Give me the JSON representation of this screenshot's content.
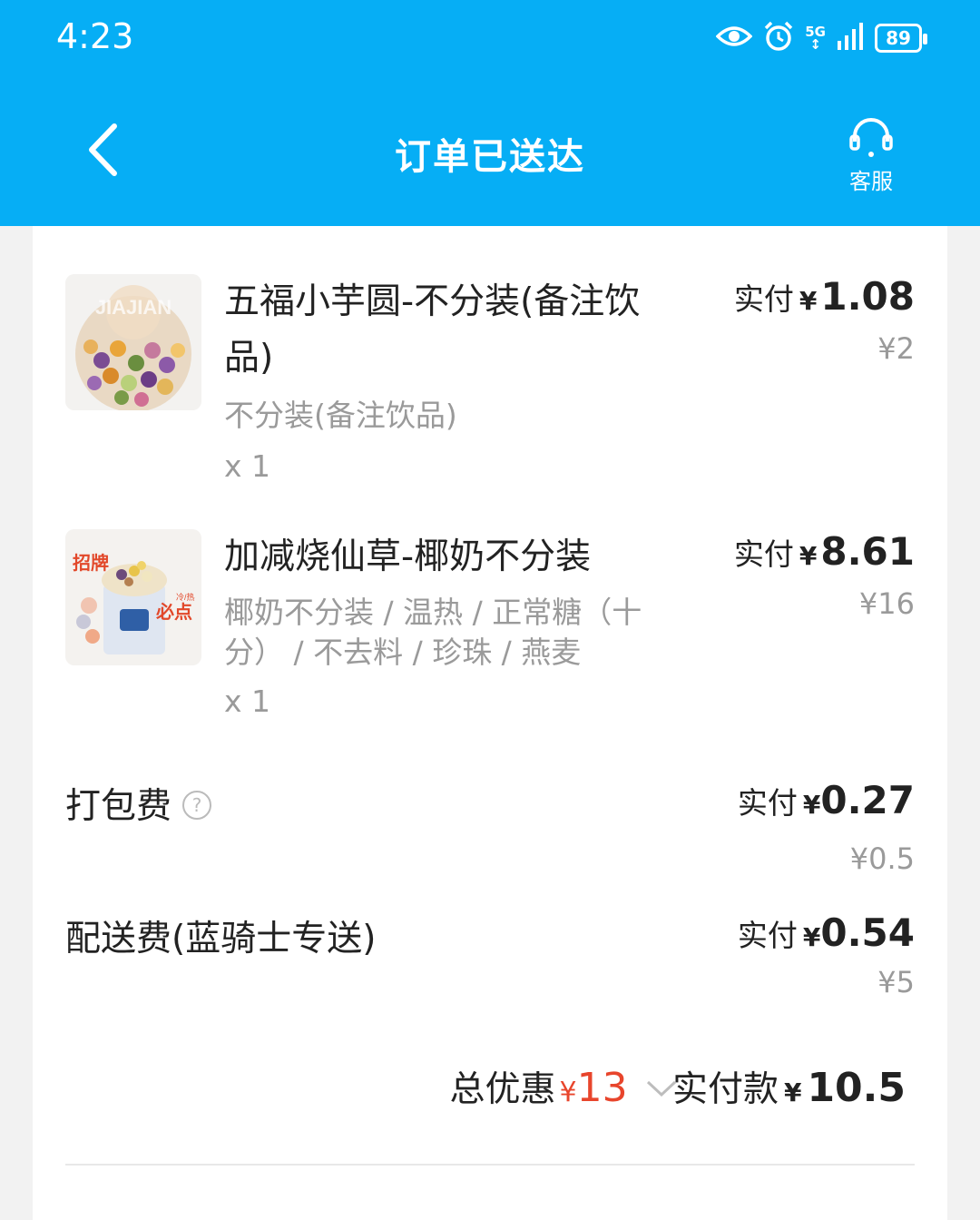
{
  "status_bar": {
    "time": "4:23",
    "network": "5G",
    "battery": "89"
  },
  "header": {
    "title": "订单已送达",
    "service_label": "客服"
  },
  "items": [
    {
      "name": "五福小芋圆-不分装(备注饮品)",
      "spec": "不分装(备注饮品)",
      "qty": "x 1",
      "paid_label": "实付",
      "currency": "¥",
      "paid_amount": "1.08",
      "original_price": "¥2",
      "thumb_text": "JIAJIAN"
    },
    {
      "name": "加减烧仙草-椰奶不分装",
      "spec": "椰奶不分装 / 温热 / 正常糖（十分） / 不去料 / 珍珠 / 燕麦",
      "qty": "x 1",
      "paid_label": "实付",
      "currency": "¥",
      "paid_amount": "8.61",
      "original_price": "¥16",
      "thumb_badge_1": "招牌",
      "thumb_badge_2": "必点",
      "thumb_badge_small": "冷/热"
    }
  ],
  "fees": [
    {
      "label": "打包费",
      "paid_label": "实付",
      "currency": "¥",
      "paid_amount": "0.27",
      "original_price": "¥0.5",
      "help_icon": "question-circle-icon"
    },
    {
      "label": "配送费(蓝骑士专送)",
      "paid_label": "实付",
      "currency": "¥",
      "paid_amount": "0.54",
      "original_price": "¥5"
    }
  ],
  "summary": {
    "discount_label": "总优惠",
    "discount_currency": "¥",
    "discount_amount": "13",
    "total_label": "实付款",
    "total_currency": "¥",
    "total_amount": "10.5"
  },
  "colors": {
    "header_bg": "#06aef5",
    "discount": "#e8452c",
    "muted": "#9a9a9a"
  }
}
